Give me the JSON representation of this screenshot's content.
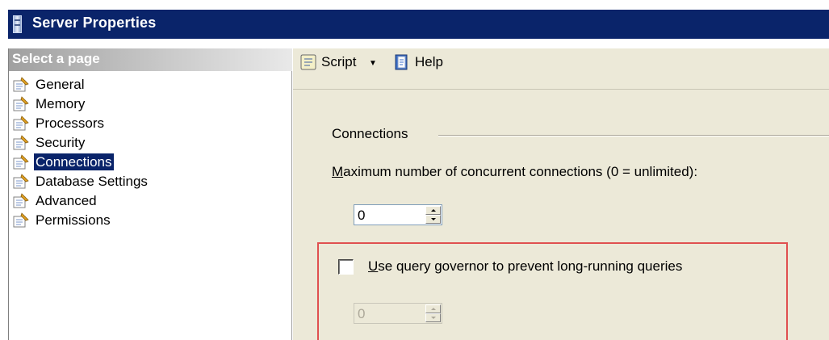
{
  "window": {
    "title": "Server Properties"
  },
  "sidebar": {
    "header": "Select a page",
    "items": [
      {
        "label": "General",
        "icon": "page-icon",
        "selected": false
      },
      {
        "label": "Memory",
        "icon": "page-icon",
        "selected": false
      },
      {
        "label": "Processors",
        "icon": "page-icon",
        "selected": false
      },
      {
        "label": "Security",
        "icon": "page-icon",
        "selected": false
      },
      {
        "label": "Connections",
        "icon": "page-icon",
        "selected": true
      },
      {
        "label": "Database Settings",
        "icon": "page-icon",
        "selected": false
      },
      {
        "label": "Advanced",
        "icon": "page-icon",
        "selected": false
      },
      {
        "label": "Permissions",
        "icon": "page-icon",
        "selected": false
      }
    ]
  },
  "toolbar": {
    "script_label": "Script",
    "script_icon": "script-icon",
    "help_label": "Help",
    "help_icon": "help-icon"
  },
  "connections": {
    "section_title": "Connections",
    "max_label_first": "M",
    "max_label_rest": "aximum number of concurrent connections (0 = unlimited):",
    "max_value": "0",
    "governor_label_first": "U",
    "governor_label_rest": "se query governor to prevent long-running queries",
    "governor_checked": false,
    "governor_value": "0"
  },
  "colors": {
    "title_bar": "#0a246a",
    "selection": "#0a246a",
    "panel": "#ece9d8",
    "highlight_box": "#e05050"
  }
}
